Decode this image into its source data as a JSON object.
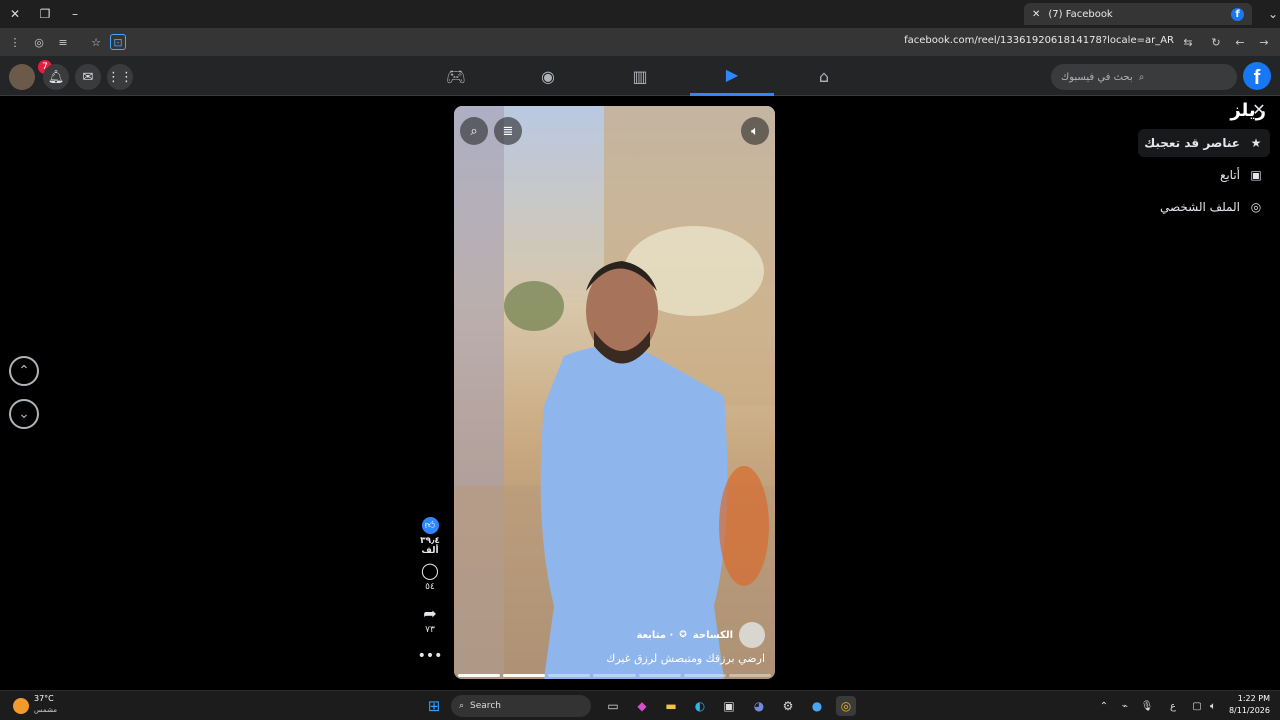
{
  "browser": {
    "tab_title": "(7) Facebook",
    "url": "facebook.com/reel/1336192061814178?locale=ar_AR",
    "window_controls": {
      "close": "✕",
      "restore": "❐",
      "minimize": "–"
    }
  },
  "header": {
    "notification_count": "7",
    "search_placeholder": "بحث في فيسبوك",
    "logo_letter": "f"
  },
  "sidebar": {
    "title": "ريلز",
    "items": [
      {
        "label": "عناصر قد تعجبك",
        "icon": "star-icon"
      },
      {
        "label": "أتابع",
        "icon": "following-icon"
      },
      {
        "label": "الملف الشخصي",
        "icon": "profile-icon"
      }
    ]
  },
  "reel": {
    "author": "الكساحة",
    "follow_label": "· متابعة",
    "caption": "ارضي برزقك ومتبصش لرزق غيرك",
    "likes": "٣٩٫٤ ألف",
    "comments": "٥٤",
    "shares": "٧٣"
  },
  "taskbar": {
    "weather_temp": "37°C",
    "weather_desc": "مشمس",
    "search_label": "Search",
    "time": "1:22 PM",
    "date": "8/11/2026",
    "lang": "ع"
  }
}
